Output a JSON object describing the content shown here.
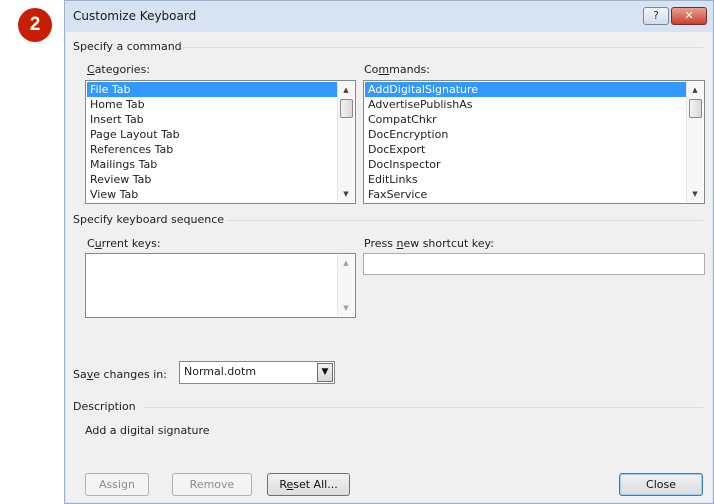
{
  "step_badge": "2",
  "window": {
    "title": "Customize Keyboard",
    "help_label": "?",
    "close_label": "✕"
  },
  "specify_command": {
    "group_label": "Specify a command",
    "categories": {
      "label_prefix": "",
      "label_underline": "C",
      "label_rest": "ategories:",
      "items": [
        "File Tab",
        "Home Tab",
        "Insert Tab",
        "Page Layout Tab",
        "References Tab",
        "Mailings Tab",
        "Review Tab",
        "View Tab"
      ],
      "selected_index": 0
    },
    "commands": {
      "label_prefix": "Co",
      "label_underline": "m",
      "label_rest": "mands:",
      "items": [
        "AddDigitalSignature",
        "AdvertisePublishAs",
        "CompatChkr",
        "DocEncryption",
        "DocExport",
        "DocInspector",
        "EditLinks",
        "FaxService"
      ],
      "selected_index": 0
    }
  },
  "keyboard_sequence": {
    "group_label": "Specify keyboard sequence",
    "current_keys": {
      "label_prefix": "C",
      "label_underline": "u",
      "label_rest": "rrent keys:"
    },
    "new_shortcut": {
      "label_prefix": "Press ",
      "label_underline": "n",
      "label_rest": "ew shortcut key:",
      "value": ""
    }
  },
  "save_changes": {
    "label_prefix": "Sa",
    "label_underline": "v",
    "label_rest": "e changes in:",
    "selected": "Normal.dotm"
  },
  "description": {
    "group_label": "Description",
    "text": "Add a digital signature"
  },
  "buttons": {
    "assign": "Assign",
    "remove": "Remove",
    "reset_prefix": "R",
    "reset_underline": "e",
    "reset_rest": "set All...",
    "close": "Close"
  },
  "scroll_glyphs": {
    "up": "▲",
    "down": "▼"
  }
}
